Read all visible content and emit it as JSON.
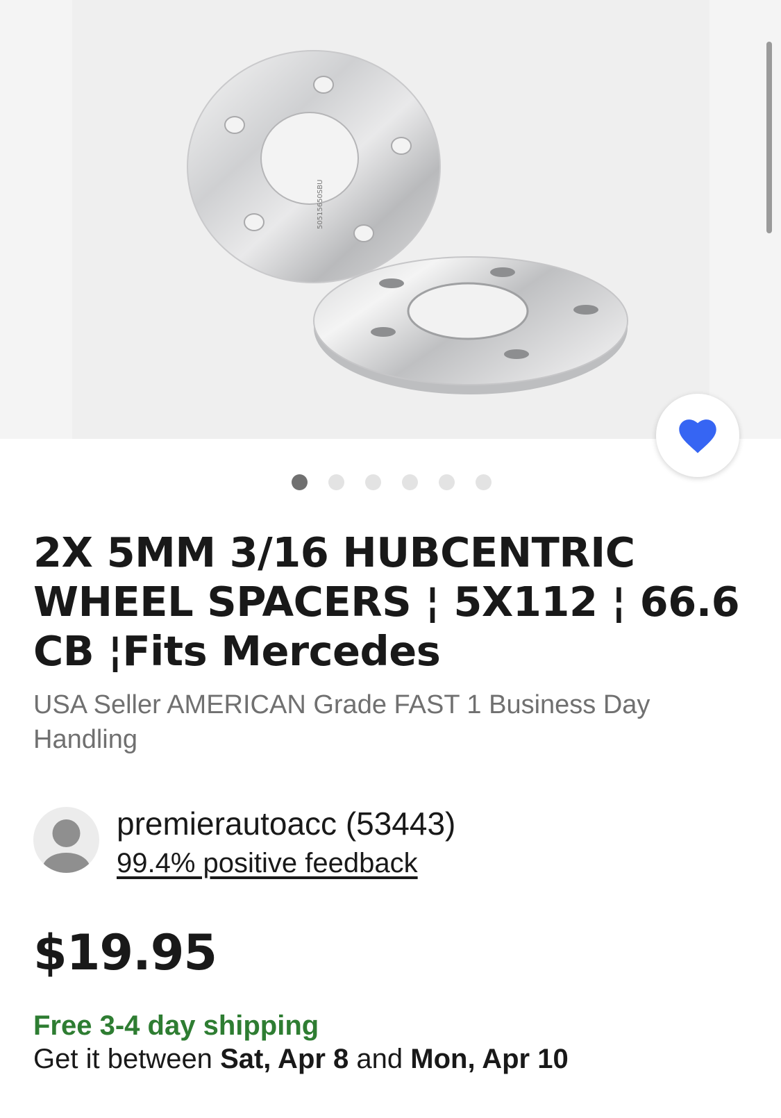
{
  "gallery": {
    "image_alt": "Wheel spacers product photo",
    "spacer_marking": "50515650SBU",
    "image_count": 6,
    "active_index": 0
  },
  "favorite": {
    "icon": "heart-icon",
    "color": "#3665f3"
  },
  "listing": {
    "title": "2X 5MM 3/16 HUBCENTRIC WHEEL SPACERS  ¦ 5X112 ¦ 66.6 CB ¦Fits Mercedes",
    "subtitle": "USA Seller AMERICAN Grade FAST 1 Business Day Handling"
  },
  "seller": {
    "name": "premierautoacc (53443)",
    "feedback": "99.4% positive feedback",
    "avatar_icon": "person-icon"
  },
  "price": "$19.95",
  "shipping": {
    "headline": "Free 3-4 day shipping",
    "prefix": "Get it between",
    "start": "Sat, Apr 8",
    "middle": "and",
    "end": "Mon, Apr 10",
    "color": "#2e7d32"
  }
}
